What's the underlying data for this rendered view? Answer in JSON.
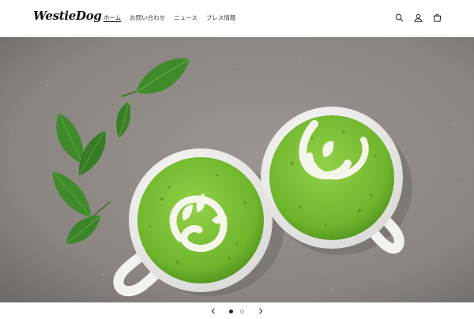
{
  "header": {
    "logo": "WestieDog",
    "nav": [
      {
        "label": "ホーム",
        "active": true
      },
      {
        "label": "お問い合わせ",
        "active": false
      },
      {
        "label": "ニュース",
        "active": false
      },
      {
        "label": "プレス情報",
        "active": false
      }
    ],
    "icons": [
      "search-icon",
      "account-icon",
      "cart-icon"
    ]
  },
  "hero": {
    "image": "two cups of matcha latte with latte art and green tea leaves on grey stone",
    "slide_count": 2,
    "active_slide": 1
  },
  "slideshow": {
    "prev_icon": "chevron-left-icon",
    "next_icon": "chevron-right-icon"
  },
  "colors": {
    "matcha": "#7cc23a",
    "stone": "#8e8a86",
    "leaf": "#3f8a2a",
    "cup": "#f7f7f5"
  }
}
